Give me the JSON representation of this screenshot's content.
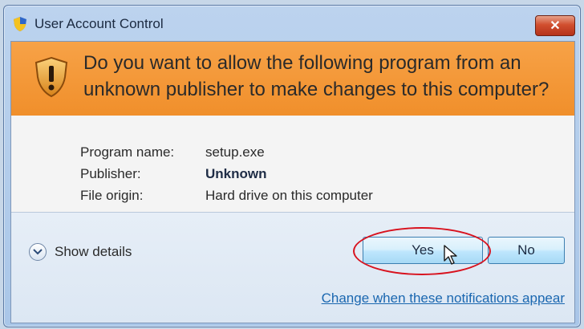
{
  "window": {
    "title": "User Account Control",
    "close_label": "✕"
  },
  "banner": {
    "question": "Do you want to allow the following program from an unknown publisher to make changes to this computer?"
  },
  "info": {
    "program_label": "Program name:",
    "program_value": "setup.exe",
    "publisher_label": "Publisher:",
    "publisher_value": "Unknown",
    "origin_label": "File origin:",
    "origin_value": "Hard drive on this computer"
  },
  "footer": {
    "details_label": "Show details",
    "yes_label": "Yes",
    "no_label": "No",
    "link_label": "Change when these notifications appear"
  },
  "colors": {
    "banner": "#f08f2b",
    "highlight_ring": "#d8121e",
    "link": "#1a67b0"
  },
  "icons": [
    "uac-shield-icon",
    "warning-shield-icon",
    "close-icon",
    "chevron-down-icon",
    "mouse-cursor-icon"
  ]
}
